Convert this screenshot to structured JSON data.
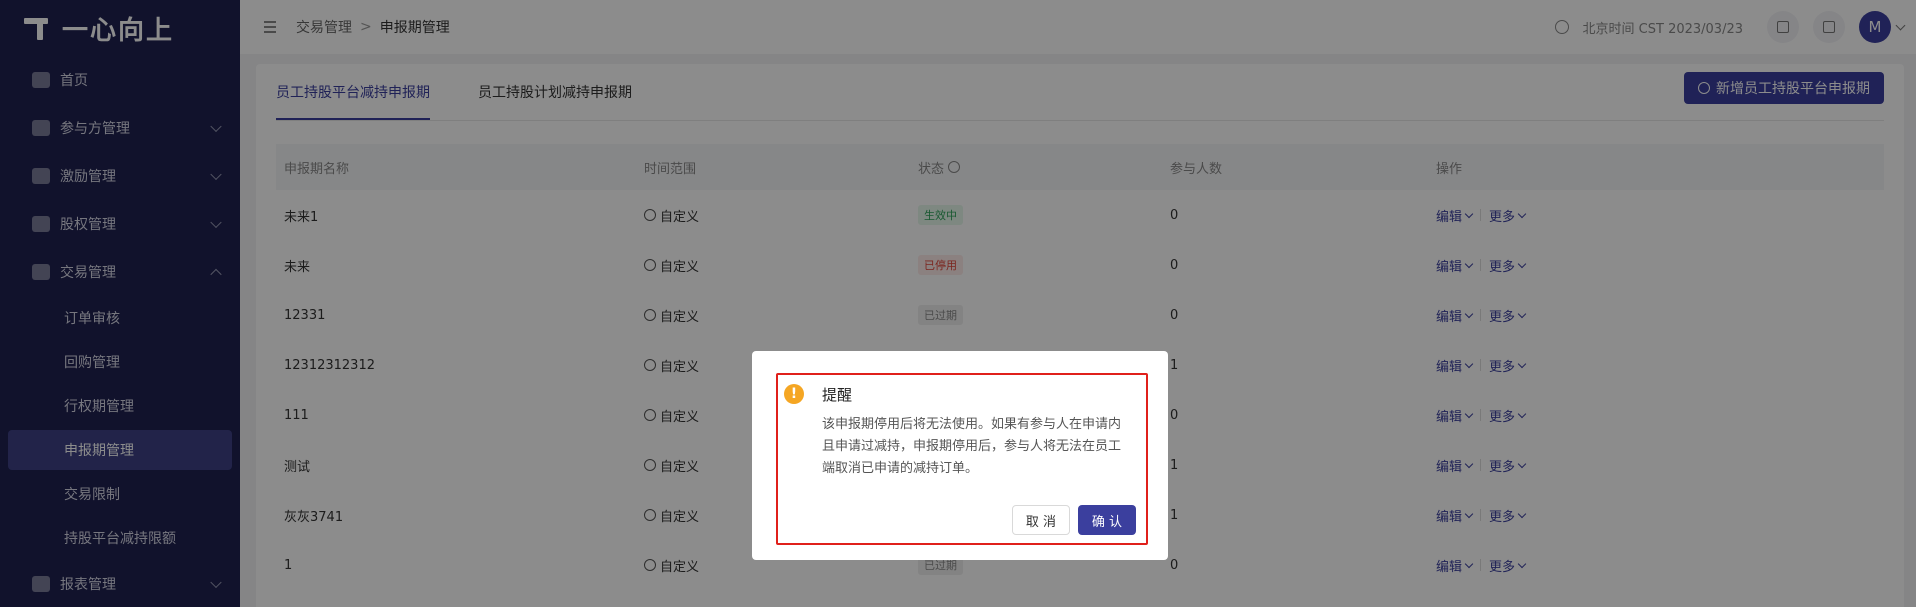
{
  "app": {
    "logo_text": "一心向上"
  },
  "sidebar": {
    "items": [
      {
        "label": "首页"
      },
      {
        "label": "参与方管理"
      },
      {
        "label": "激励管理"
      },
      {
        "label": "股权管理"
      },
      {
        "label": "交易管理"
      }
    ],
    "subitems": [
      {
        "label": "订单审核"
      },
      {
        "label": "回购管理"
      },
      {
        "label": "行权期管理"
      },
      {
        "label": "申报期管理"
      },
      {
        "label": "交易限制"
      },
      {
        "label": "持股平台减持限额"
      }
    ],
    "last_item": {
      "label": "报表管理"
    }
  },
  "header": {
    "breadcrumb": [
      "交易管理",
      ">",
      "申报期管理"
    ],
    "time_text": "北京时间 CST 2023/03/23",
    "avatar_letter": "M"
  },
  "main": {
    "tabs": [
      {
        "label": "员工持股平台减持申报期"
      },
      {
        "label": "员工持股计划减持申报期"
      }
    ],
    "add_button": "新增员工持股平台申报期",
    "columns": [
      "申报期名称",
      "时间范围",
      "状态",
      "参与人数",
      "操作"
    ],
    "rows": [
      {
        "name": "未来1",
        "range": "自定义",
        "status": "生效中",
        "count": "0"
      },
      {
        "name": "未来",
        "range": "自定义",
        "status": "已停用",
        "count": "0"
      },
      {
        "name": "12331",
        "range": "自定义",
        "status": "已过期",
        "count": "0"
      },
      {
        "name": "12312312312",
        "range": "自定义",
        "status": "",
        "count": "1"
      },
      {
        "name": "111",
        "range": "自定义",
        "status": "",
        "count": "0"
      },
      {
        "name": "测试",
        "range": "自定义",
        "status": "",
        "count": "1"
      },
      {
        "name": "灰灰3741",
        "range": "自定义",
        "status": "",
        "count": "1"
      },
      {
        "name": "1",
        "range": "自定义",
        "status": "已过期",
        "count": "0"
      }
    ],
    "op_edit": "编辑",
    "op_more": "更多"
  },
  "status_colors": {
    "生效中": {
      "bg": "#e6f7ec",
      "fg": "#2ea35a"
    },
    "已停用": {
      "bg": "#fdecea",
      "fg": "#e0453a"
    },
    "已过期": {
      "bg": "#eeeeee",
      "fg": "#888888"
    }
  },
  "modal": {
    "title": "提醒",
    "body": "该申报期停用后将无法使用。如果有参与人在申请内且申请过减持，申报期停用后，参与人将无法在员工端取消已申请的减持订单。",
    "cancel": "取 消",
    "confirm": "确 认",
    "icon": "warning-icon"
  }
}
